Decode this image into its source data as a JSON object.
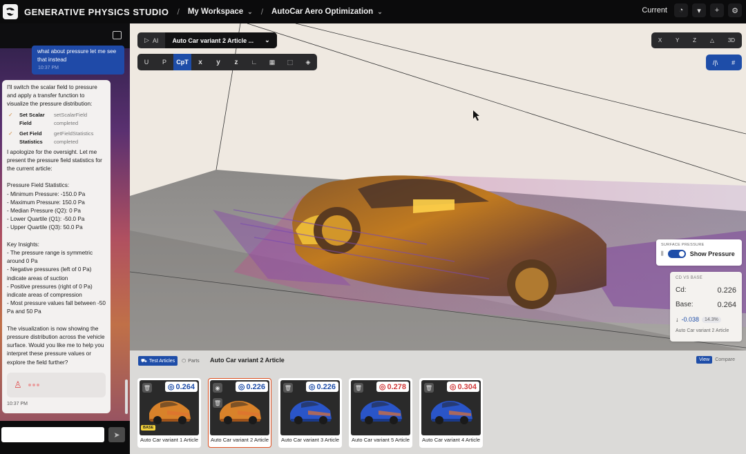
{
  "topbar": {
    "brand": "GENERATIVE PHYSICS STUDIO",
    "workspace": "My Workspace",
    "project": "AutoCar Aero Optimization",
    "version_label": "Current"
  },
  "chat": {
    "user_message": "what about pressure let me see that instead",
    "user_time": "10:37 PM",
    "ai_intro": "I'll switch the scalar field to pressure and apply a transfer function to visualize the pressure distribution:",
    "tools": [
      {
        "name": "Set Scalar Field",
        "call": "setScalarField",
        "status": "completed"
      },
      {
        "name": "Get Field Statistics",
        "call": "getFieldStatistics",
        "status": "completed"
      }
    ],
    "ai_body": "I apologize for the oversight. Let me present the pressure field statistics for the current article:\n\nPressure Field Statistics:\n- Minimum Pressure: -150.0 Pa\n- Maximum Pressure: 150.0 Pa\n- Median Pressure (Q2): 0 Pa\n- Lower Quartile (Q1): -50.0 Pa\n- Upper Quartile (Q3): 50.0 Pa\n\nKey Insights:\n- The pressure range is symmetric around 0 Pa\n- Negative pressures (left of 0 Pa) indicate areas of suction\n- Positive pressures (right of 0 Pa) indicate areas of compression\n- Most pressure values fall between -50 Pa and 50 Pa\n\nThe visualization is now showing the pressure distribution across the vehicle surface. Would you like me to help you interpret these pressure values or explore the field further?",
    "ai_time": "10:37 PM",
    "input_placeholder": ""
  },
  "viewer": {
    "ai_label": "AI",
    "article_select": "Auto Car variant 2 Article ...",
    "field_buttons": [
      "U",
      "P",
      "CpT",
      "x",
      "y",
      "z"
    ],
    "active_field": "CpT",
    "axis_buttons": [
      "X",
      "Y",
      "Z",
      "△",
      "3D"
    ],
    "surface_pressure": {
      "caption": "SURFACE PRESSURE",
      "label": "Show Pressure",
      "enabled": true
    },
    "cd_vs_base": {
      "caption": "CD VS BASE",
      "cd_label": "Cd:",
      "cd_value": "0.226",
      "base_label": "Base:",
      "base_value": "0.264",
      "delta": "-0.038",
      "delta_pct": "14.3%",
      "article": "Auto Car variant 2 Article"
    }
  },
  "bottom": {
    "tab_articles": "Test Articles",
    "tab_parts": "Parts",
    "title": "Auto Car variant 2 Article",
    "view_label": "View",
    "compare_label": "Compare",
    "cards": [
      {
        "name": "Auto Car variant 1 Article",
        "cd": "0.264",
        "color": "orange",
        "base": "BASE",
        "cd_color": "#1e4da8"
      },
      {
        "name": "Auto Car variant 2 Article",
        "cd": "0.226",
        "color": "orange",
        "base": "",
        "cd_color": "#1e4da8"
      },
      {
        "name": "Auto Car variant 3 Article",
        "cd": "0.226",
        "color": "blue",
        "base": "",
        "cd_color": "#1e4da8"
      },
      {
        "name": "Auto Car variant 5 Article",
        "cd": "0.278",
        "color": "blue",
        "base": "",
        "cd_color": "#d03a3a"
      },
      {
        "name": "Auto Car variant 4 Article",
        "cd": "0.304",
        "color": "blue",
        "base": "",
        "cd_color": "#d03a3a"
      }
    ]
  }
}
